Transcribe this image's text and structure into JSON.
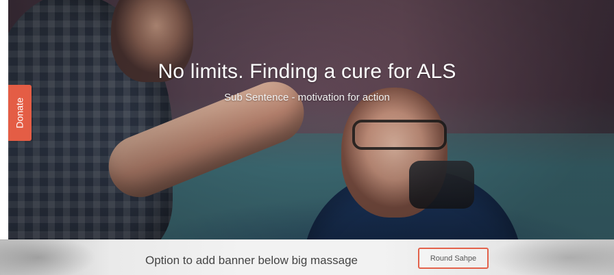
{
  "hero": {
    "headline": "No limits. Finding a cure for ALS",
    "subline": "Sub Sentence  - motivation for action"
  },
  "donate": {
    "label": "Donate",
    "accent": "#e45d45"
  },
  "banner": {
    "text": "Option to add banner below big massage",
    "button_label": "Round Sahpe",
    "button_border": "#e3614a"
  }
}
